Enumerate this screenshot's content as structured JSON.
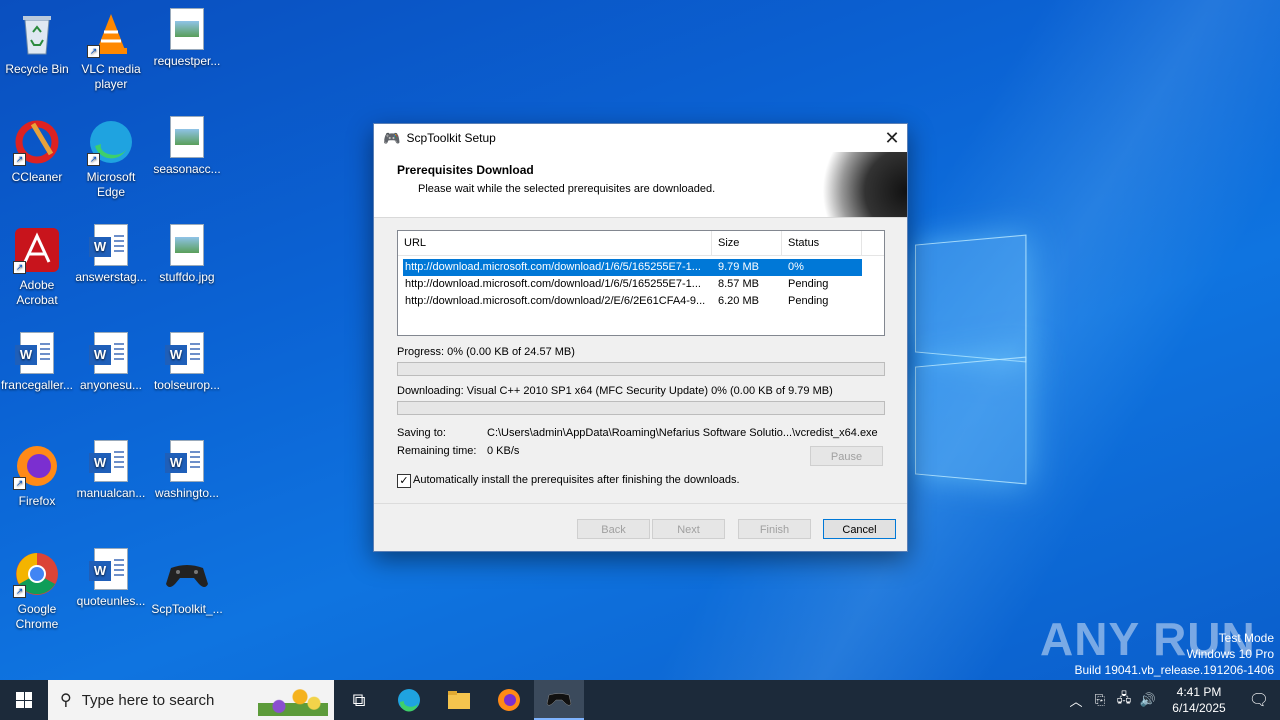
{
  "desktop": {
    "icons": [
      {
        "label": "Recycle Bin"
      },
      {
        "label": "VLC media player"
      },
      {
        "label": "requestper..."
      },
      {
        "label": "CCleaner"
      },
      {
        "label": "Microsoft Edge"
      },
      {
        "label": "seasonacc..."
      },
      {
        "label": "Adobe Acrobat"
      },
      {
        "label": "answerstag..."
      },
      {
        "label": "stuffdo.jpg"
      },
      {
        "label": "francegaller..."
      },
      {
        "label": "anyonesu..."
      },
      {
        "label": "toolseurop..."
      },
      {
        "label": "Firefox"
      },
      {
        "label": "manualcan..."
      },
      {
        "label": "washingto..."
      },
      {
        "label": "Google Chrome"
      },
      {
        "label": "quoteunles..."
      },
      {
        "label": "ScpToolkit_..."
      }
    ]
  },
  "dialog": {
    "title": "ScpToolkit Setup",
    "header_title": "Prerequisites Download",
    "header_subtitle": "Please wait while the selected prerequisites are downloaded.",
    "columns": {
      "url": "URL",
      "size": "Size",
      "status": "Status"
    },
    "rows": [
      {
        "url": "http://download.microsoft.com/download/1/6/5/165255E7-1...",
        "size": "9.79 MB",
        "status": "0%"
      },
      {
        "url": "http://download.microsoft.com/download/1/6/5/165255E7-1...",
        "size": "8.57 MB",
        "status": "Pending"
      },
      {
        "url": "http://download.microsoft.com/download/2/E/6/2E61CFA4-9...",
        "size": "6.20 MB",
        "status": "Pending"
      }
    ],
    "progress_label": "Progress: 0% (0.00 KB of 24.57 MB)",
    "progress_fraction": 0,
    "downloading_label": "Downloading: Visual C++ 2010 SP1 x64 (MFC Security Update) 0%  (0.00 KB of 9.79 MB)",
    "downloading_fraction": 0,
    "saving_to_label": "Saving to:",
    "saving_to_value": "C:\\Users\\admin\\AppData\\Roaming\\Nefarius Software Solutio...\\vcredist_x64.exe",
    "remaining_label": "Remaining time:",
    "remaining_value": "0 KB/s",
    "pause_label": "Pause",
    "auto_install_label": "Automatically install the prerequisites after finishing the downloads.",
    "auto_install_checked": true,
    "back_label": "Back",
    "next_label": "Next",
    "finish_label": "Finish",
    "cancel_label": "Cancel"
  },
  "taskbar": {
    "search_placeholder": "Type here to search",
    "time": "4:41 PM",
    "date": "6/14/2025"
  },
  "watermark": {
    "brand": "ANY RUN",
    "line1": "Test Mode",
    "line2": "Windows 10 Pro",
    "line3": "Build 19041.vb_release.191206-1406"
  }
}
